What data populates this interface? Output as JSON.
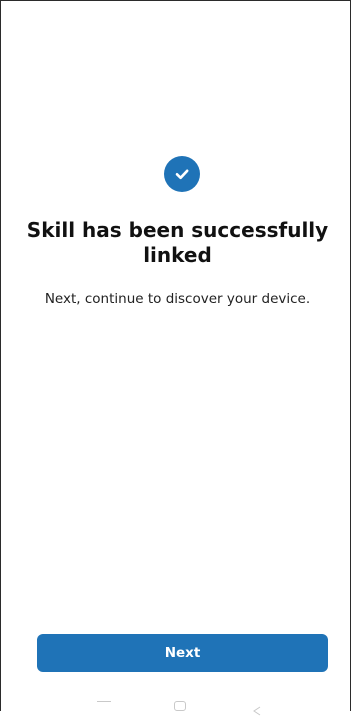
{
  "status": {
    "icon": "checkmark-circle-icon",
    "accent_color": "#1f73b7"
  },
  "title": "Skill has been successfully linked",
  "subtitle": "Next, continue to discover your device.",
  "next_button": {
    "label": "Next",
    "color": "#1f73b7"
  },
  "system_nav": {
    "icons": [
      "recents-icon",
      "home-icon",
      "back-icon"
    ]
  }
}
